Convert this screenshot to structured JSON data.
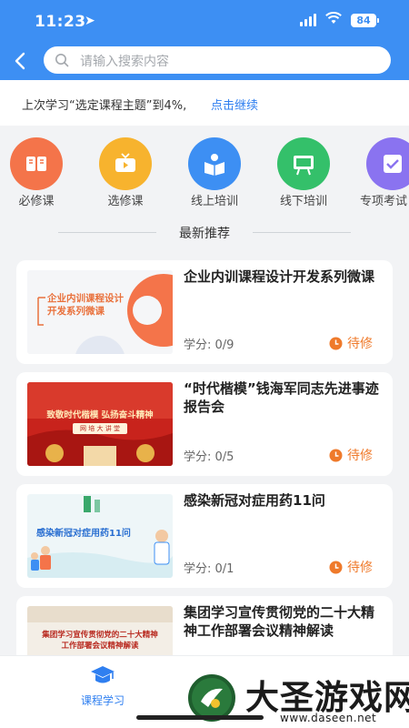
{
  "status_bar": {
    "time": "11:23",
    "battery": "84"
  },
  "search": {
    "placeholder": "请输入搜索内容"
  },
  "last_study": {
    "text": "上次学习“选定课程主题”到4%,",
    "link": "点击继续"
  },
  "categories": [
    {
      "label": "必修课",
      "icon": "book-icon",
      "color": "#f4744a"
    },
    {
      "label": "选修课",
      "icon": "tv-icon",
      "color": "#f7b32e"
    },
    {
      "label": "线上培训",
      "icon": "reader-icon",
      "color": "#3d8ff3"
    },
    {
      "label": "线下培训",
      "icon": "board-icon",
      "color": "#34c06a"
    },
    {
      "label": "专项考试",
      "icon": "exam-icon",
      "color": "#8a73f0"
    }
  ],
  "section": {
    "title": "最新推荐"
  },
  "courses": [
    {
      "title": "企业内训课程设计开发系列微课",
      "credit_label": "学分:",
      "credit_value": "0/9",
      "status": "待修",
      "thumb_text": [
        "企业内训课程设计",
        "开发系列微课"
      ]
    },
    {
      "title": "“时代楷模”钱海军同志先进事迹报告会",
      "credit_label": "学分:",
      "credit_value": "0/5",
      "status": "待修",
      "thumb_text": [
        "致敬时代楷模 弘扬奋斗精神",
        "网 培 大 讲 堂"
      ]
    },
    {
      "title": "感染新冠对症用药11问",
      "credit_label": "学分:",
      "credit_value": "0/1",
      "status": "待修",
      "thumb_text": [
        "感染新冠对症用药11问"
      ]
    },
    {
      "title": "集团学习宣传贯彻党的二十大精神工作部署会议精神解读",
      "thumb_text": [
        "集团学习宣传贯彻党的二十大精神",
        "工作部署会议精神解读"
      ]
    }
  ],
  "tabbar": {
    "active_label": "课程学习"
  },
  "watermark": {
    "brand": "大圣游戏网",
    "url": "www.daseen.net"
  },
  "colors": {
    "primary": "#3d8ff3",
    "accent": "#ef7a2b",
    "link": "#2f7ff0"
  }
}
